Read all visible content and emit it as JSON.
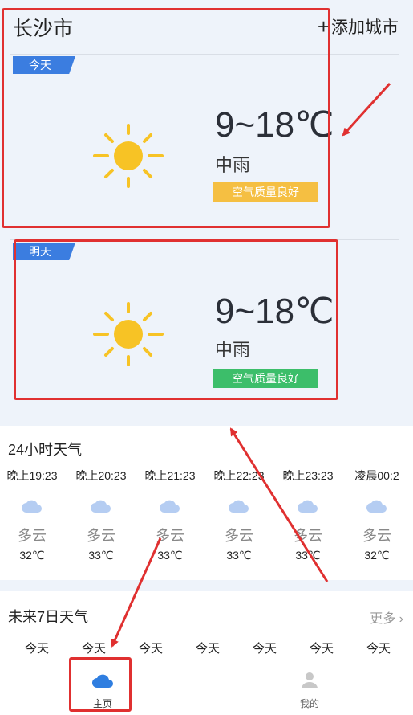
{
  "header": {
    "city": "长沙市",
    "add_city": "添加城市"
  },
  "today": {
    "tag": "今天",
    "temp": "9~18℃",
    "condition": "中雨",
    "air_quality": "空气质量良好",
    "aq_color": "#f5bf42"
  },
  "tomorrow": {
    "tag": "明天",
    "temp": "9~18℃",
    "condition": "中雨",
    "air_quality": "空气质量良好",
    "aq_color": "#3cbe6a"
  },
  "hourly": {
    "title": "24小时天气",
    "items": [
      {
        "time": "晚上19:23",
        "condition": "多云",
        "temp": "32℃"
      },
      {
        "time": "晚上20:23",
        "condition": "多云",
        "temp": "33℃"
      },
      {
        "time": "晚上21:23",
        "condition": "多云",
        "temp": "33℃"
      },
      {
        "time": "晚上22:23",
        "condition": "多云",
        "temp": "33℃"
      },
      {
        "time": "晚上23:23",
        "condition": "多云",
        "temp": "33℃"
      },
      {
        "time": "凌晨00:2",
        "condition": "多云",
        "temp": "32℃"
      }
    ]
  },
  "weekly": {
    "title": "未来7日天气",
    "more": "更多",
    "days": [
      "今天",
      "今天",
      "今天",
      "今天",
      "今天",
      "今天",
      "今天"
    ]
  },
  "tabbar": {
    "home": "主页",
    "mine": "我的"
  },
  "colors": {
    "accent": "#3b7de0",
    "sun": "#f7c325",
    "annotation": "#e03030"
  }
}
